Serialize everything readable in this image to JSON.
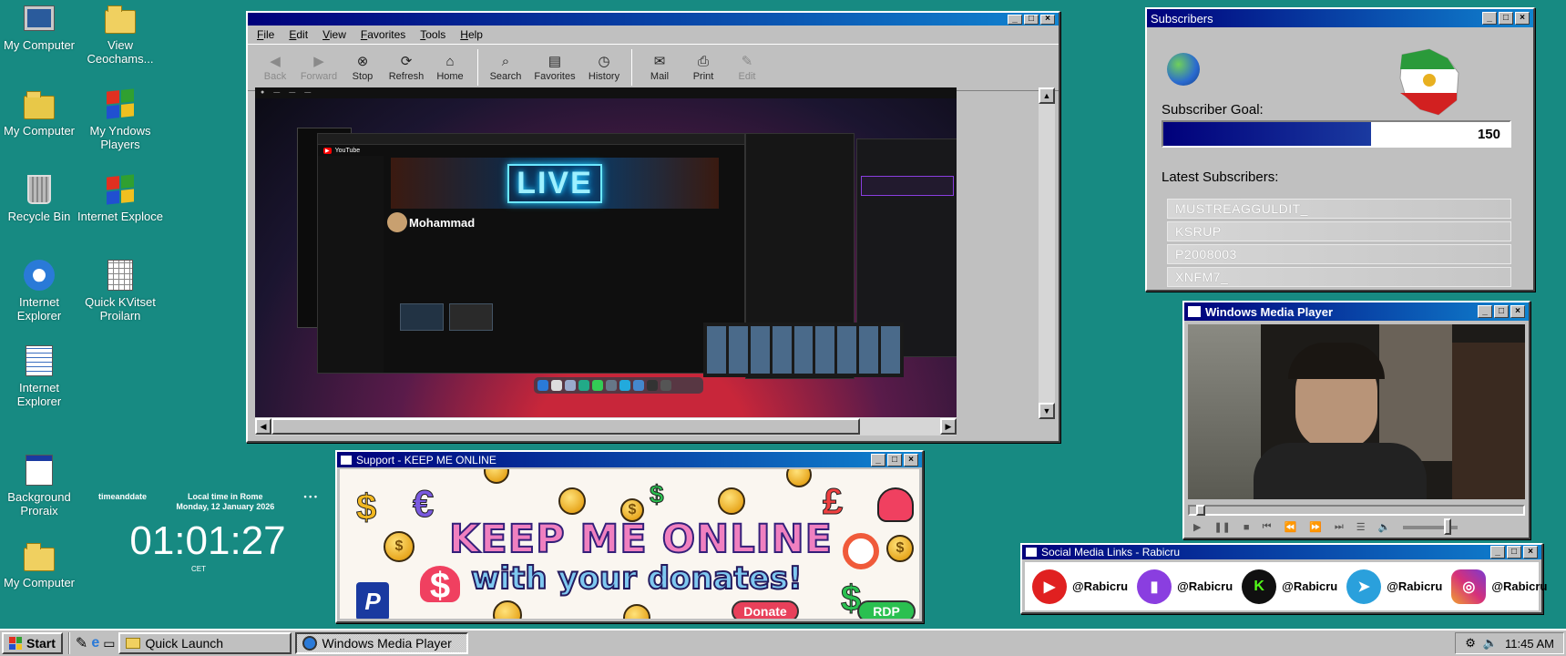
{
  "desktop_icons": [
    {
      "label": "My Computer",
      "icon": "my-computer-icon"
    },
    {
      "label": "View Ceochams...",
      "icon": "folder-icon"
    },
    {
      "label": "My Computer",
      "icon": "my-documents-icon"
    },
    {
      "label": "My Yndows Players",
      "icon": "windows-logo-icon"
    },
    {
      "label": "Recycle Bin",
      "icon": "recycle-bin-icon"
    },
    {
      "label": "Internet Exploce",
      "icon": "windows-logo-icon"
    },
    {
      "label": "Internet Explorer",
      "icon": "internet-explorer-icon"
    },
    {
      "label": "Quick KVitset Proilarn",
      "icon": "calculator-icon"
    },
    {
      "label": "Internet Explorer",
      "icon": "document-icon"
    },
    {
      "label": "Background Proraix",
      "icon": "app-window-icon"
    },
    {
      "label": "My Computer",
      "icon": "folder-icon"
    }
  ],
  "browser": {
    "menu": [
      "File",
      "Edit",
      "View",
      "Favorites",
      "Tools",
      "Help"
    ],
    "toolbar": [
      {
        "label": "Back",
        "icon": "back-arrow-icon",
        "enabled": false
      },
      {
        "label": "Forward",
        "icon": "forward-arrow-icon",
        "enabled": false
      },
      {
        "label": "Stop",
        "icon": "stop-icon",
        "enabled": true
      },
      {
        "label": "Refresh",
        "icon": "refresh-icon",
        "enabled": true
      },
      {
        "label": "Home",
        "icon": "home-icon",
        "enabled": true
      },
      {
        "label": "Search",
        "icon": "search-icon",
        "enabled": true
      },
      {
        "label": "Favorites",
        "icon": "favorites-icon",
        "enabled": true
      },
      {
        "label": "History",
        "icon": "history-icon",
        "enabled": true
      },
      {
        "label": "Mail",
        "icon": "mail-icon",
        "enabled": true
      },
      {
        "label": "Print",
        "icon": "print-icon",
        "enabled": true
      },
      {
        "label": "Edit",
        "icon": "edit-icon",
        "enabled": false
      }
    ],
    "screen": {
      "yt_logo": "YouTube",
      "live_text": "LIVE",
      "channel_name": "Mohammad"
    }
  },
  "subscribers": {
    "title": "Subscribers",
    "goal_label": "Subscriber Goal:",
    "goal_value": "150",
    "goal_progress": 0.6,
    "latest_label": "Latest Subscribers:",
    "latest": [
      "MUSTREAGGULDIT_",
      "KSRUP",
      "P2008003",
      "XNFM7_"
    ]
  },
  "media_player": {
    "title": "Windows Media Player",
    "seek_progress": 0.02,
    "volume_level": 0.75
  },
  "support": {
    "title": "Support - KEEP ME ONLINE",
    "headline": "KEEP ME ONLINE",
    "subline": "with your donates!",
    "donate_label": "Donate",
    "rdp_label": "RDP",
    "symbols": [
      "$",
      "€",
      "$",
      "£",
      "$",
      "$"
    ]
  },
  "clock": {
    "brand": "timeanddate",
    "local_label": "Local time in Rome",
    "date": "Monday, 12 January 2026",
    "time": "01:01:27",
    "zone": "CET"
  },
  "social": {
    "title": "Social Media Links - Rabicru",
    "links": [
      {
        "platform": "youtube",
        "icon": "youtube-icon",
        "handle": "@Rabicru",
        "color": "#e02020"
      },
      {
        "platform": "twitch",
        "icon": "twitch-icon",
        "handle": "@Rabicru",
        "color": "#8a3ee0"
      },
      {
        "platform": "kick",
        "icon": "kick-icon",
        "handle": "@Rabicru",
        "color": "#101010"
      },
      {
        "platform": "telegram",
        "icon": "telegram-icon",
        "handle": "@Rabicru",
        "color": "#2aa0dc"
      },
      {
        "platform": "instagram",
        "icon": "instagram-icon",
        "handle": "@Rabicru",
        "color": "#d6307a"
      }
    ]
  },
  "taskbar": {
    "start_label": "Start",
    "items": [
      {
        "label": "Quick Launch",
        "icon": "folder-icon",
        "active": false
      },
      {
        "label": "Windows Media Player",
        "icon": "media-player-icon",
        "active": true
      }
    ],
    "time": "11:45 AM"
  },
  "colors": {
    "desktop": "#178a82",
    "titlebar_start": "#00007b",
    "titlebar_end": "#1084d0",
    "window_face": "#c0c0c0"
  }
}
